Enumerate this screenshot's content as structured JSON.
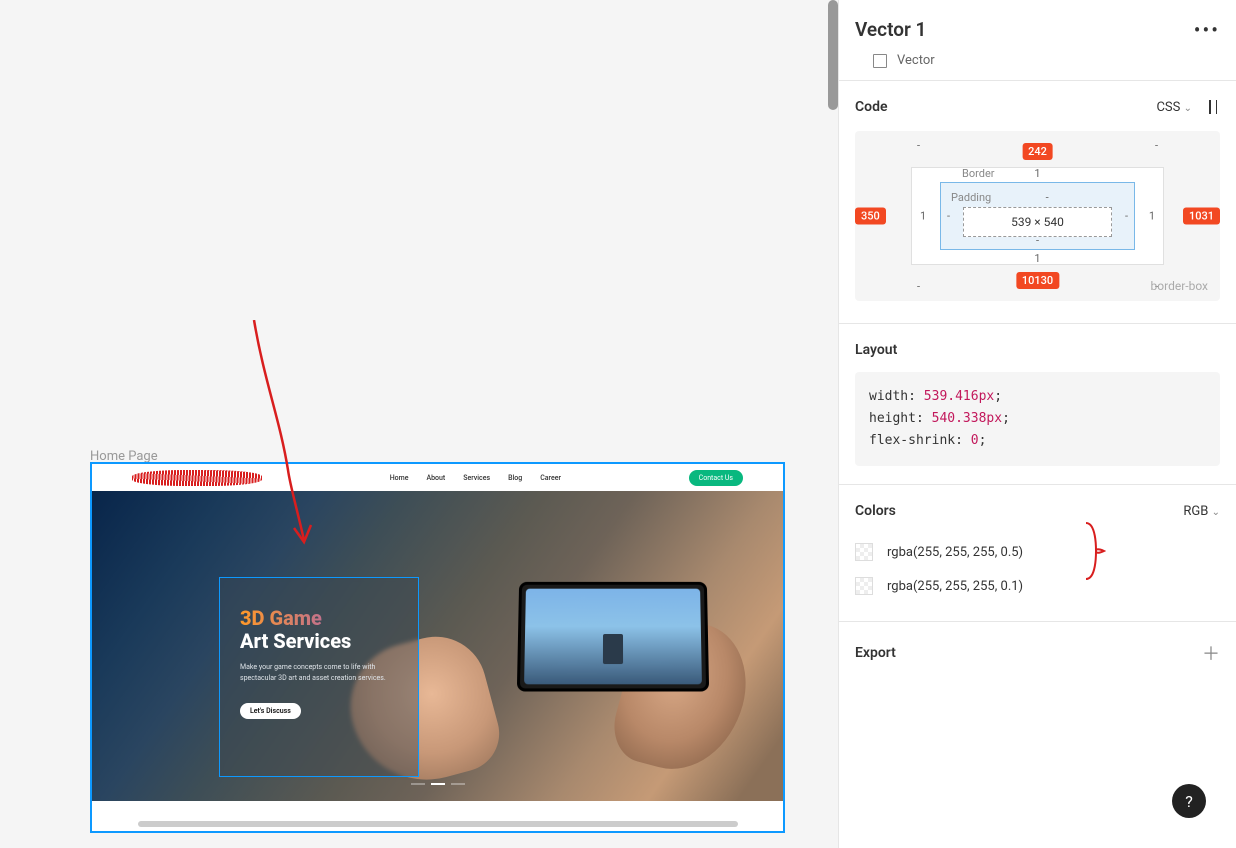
{
  "canvas": {
    "frame_label": "Home Page",
    "mock": {
      "nav_items": [
        "Home",
        "About",
        "Services",
        "Blog",
        "Career"
      ],
      "cta": "Contact Us",
      "hero": {
        "title_1": "3D Game",
        "title_2": "Art Services",
        "body": "Make your game concepts come to life with spectacular 3D art and asset creation services.",
        "button": "Let's Discuss"
      }
    }
  },
  "panel": {
    "layer_name": "Vector 1",
    "layer_type": "Vector",
    "code": {
      "section_label": "Code",
      "lang": "CSS",
      "box_sizing": "border-box",
      "margin": {
        "top": "242",
        "right": "1031",
        "bottom": "10130",
        "left": "350"
      },
      "border": {
        "label": "Border",
        "top": "1",
        "right": "1",
        "bottom": "1",
        "left": "1"
      },
      "padding": {
        "label": "Padding",
        "top": "-",
        "right": "-",
        "bottom": "-",
        "left": "-"
      },
      "content": "539 × 540"
    },
    "layout": {
      "section_label": "Layout",
      "lines": [
        {
          "prop": "width",
          "value": "539.416px"
        },
        {
          "prop": "height",
          "value": "540.338px"
        },
        {
          "prop": "flex-shrink",
          "value": "0"
        }
      ]
    },
    "colors": {
      "section_label": "Colors",
      "mode": "RGB",
      "items": [
        "rgba(255, 255, 255, 0.5)",
        "rgba(255, 255, 255, 0.1)"
      ]
    },
    "export": {
      "section_label": "Export"
    }
  }
}
